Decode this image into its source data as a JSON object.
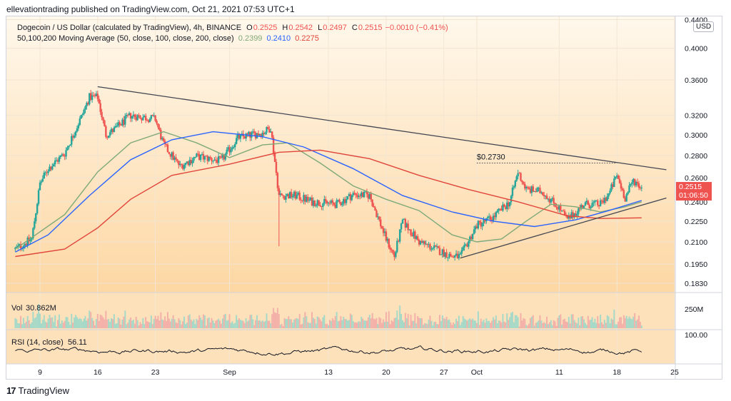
{
  "caption": "ellevationtrading published on TradingView.com, Oct 21, 2021 07:53 UTC+1",
  "legend": {
    "symbol": "Dogecoin / US Dollar (calculated by TradingView), 4h, BINANCE",
    "o_label": "O",
    "o": "0.2525",
    "h_label": "H",
    "h": "0.2542",
    "l_label": "L",
    "l": "0.2497",
    "c_label": "C",
    "c": "0.2515",
    "change": "−0.0010 (−0.41%)",
    "ma_title": "50,100,200 Moving Average (50, close, 100, close, 200, close)",
    "ma50": "0.2399",
    "ma100": "0.2410",
    "ma200": "0.2275"
  },
  "currency": "USD",
  "annotation_price": "$0.2730",
  "last_price": "0.2515",
  "countdown": "01:06:50",
  "volume_label": "Vol",
  "volume_value": "30.862M",
  "volume_axis": "250M",
  "rsi_label": "RSI (14, close)",
  "rsi_value": "56.11",
  "rsi_axis": "100.00",
  "footer": {
    "logo": "17",
    "brand": "TradingView"
  },
  "colors": {
    "bg_top": "#fff8ec",
    "bg_bottom": "#fdd7a3",
    "up": "#26a69a",
    "down": "#ef5350",
    "ma50": "#7fa978",
    "ma100": "#2962ff",
    "ma200": "#e0453b",
    "trendline": "#434651"
  },
  "chart_data": {
    "type": "candlestick",
    "title": "Dogecoin / US Dollar (calculated by TradingView), 4h, BINANCE",
    "y_scale": "log",
    "ylim": [
      0.176,
      0.44
    ],
    "y_ticks": [
      "0.4400",
      "0.4000",
      "0.3600",
      "0.3200",
      "0.3000",
      "0.2800",
      "0.2600",
      "0.2400",
      "0.2250",
      "0.2100",
      "0.1950",
      "0.1830"
    ],
    "x_ticks": [
      "9",
      "16",
      "23",
      "Sep",
      "13",
      "20",
      "27",
      "Oct",
      "11",
      "18",
      "25"
    ],
    "price_path": [
      [
        "2021-08-06",
        0.205
      ],
      [
        "2021-08-08",
        0.212
      ],
      [
        "2021-08-09",
        0.255
      ],
      [
        "2021-08-10",
        0.268
      ],
      [
        "2021-08-12",
        0.282
      ],
      [
        "2021-08-14",
        0.318
      ],
      [
        "2021-08-15",
        0.34
      ],
      [
        "2021-08-16",
        0.34
      ],
      [
        "2021-08-17",
        0.3
      ],
      [
        "2021-08-18",
        0.305
      ],
      [
        "2021-08-20",
        0.32
      ],
      [
        "2021-08-23",
        0.316
      ],
      [
        "2021-08-24",
        0.29
      ],
      [
        "2021-08-26",
        0.27
      ],
      [
        "2021-08-28",
        0.279
      ],
      [
        "2021-08-31",
        0.275
      ],
      [
        "2021-09-02",
        0.297
      ],
      [
        "2021-09-05",
        0.302
      ],
      [
        "2021-09-06",
        0.307
      ],
      [
        "2021-09-07",
        0.245
      ],
      [
        "2021-09-09",
        0.245
      ],
      [
        "2021-09-11",
        0.24
      ],
      [
        "2021-09-14",
        0.238
      ],
      [
        "2021-09-16",
        0.246
      ],
      [
        "2021-09-18",
        0.245
      ],
      [
        "2021-09-20",
        0.212
      ],
      [
        "2021-09-21",
        0.2
      ],
      [
        "2021-09-22",
        0.225
      ],
      [
        "2021-09-24",
        0.21
      ],
      [
        "2021-09-26",
        0.205
      ],
      [
        "2021-09-28",
        0.2
      ],
      [
        "2021-09-29",
        0.2
      ],
      [
        "2021-10-01",
        0.222
      ],
      [
        "2021-10-03",
        0.228
      ],
      [
        "2021-10-05",
        0.24
      ],
      [
        "2021-10-06",
        0.265
      ],
      [
        "2021-10-07",
        0.25
      ],
      [
        "2021-10-09",
        0.248
      ],
      [
        "2021-10-11",
        0.235
      ],
      [
        "2021-10-12",
        0.226
      ],
      [
        "2021-10-14",
        0.238
      ],
      [
        "2021-10-16",
        0.238
      ],
      [
        "2021-10-17",
        0.246
      ],
      [
        "2021-10-18",
        0.262
      ],
      [
        "2021-10-19",
        0.243
      ],
      [
        "2021-10-20",
        0.258
      ],
      [
        "2021-10-21",
        0.2515
      ]
    ],
    "spike_low": {
      "date": "2021-09-07",
      "value": 0.207
    },
    "series": [
      {
        "name": "MA 50",
        "values": [
          [
            "2021-08-06",
            0.205
          ],
          [
            "2021-08-12",
            0.23
          ],
          [
            "2021-08-16",
            0.265
          ],
          [
            "2021-08-20",
            0.292
          ],
          [
            "2021-08-24",
            0.303
          ],
          [
            "2021-08-28",
            0.292
          ],
          [
            "2021-09-01",
            0.278
          ],
          [
            "2021-09-05",
            0.29
          ],
          [
            "2021-09-08",
            0.292
          ],
          [
            "2021-09-12",
            0.273
          ],
          [
            "2021-09-16",
            0.253
          ],
          [
            "2021-09-20",
            0.242
          ],
          [
            "2021-09-24",
            0.233
          ],
          [
            "2021-09-28",
            0.215
          ],
          [
            "2021-10-01",
            0.21
          ],
          [
            "2021-10-04",
            0.212
          ],
          [
            "2021-10-07",
            0.225
          ],
          [
            "2021-10-10",
            0.238
          ],
          [
            "2021-10-13",
            0.236
          ],
          [
            "2021-10-16",
            0.232
          ],
          [
            "2021-10-19",
            0.236
          ],
          [
            "2021-10-21",
            0.2399
          ]
        ]
      },
      {
        "name": "MA 100",
        "values": [
          [
            "2021-08-06",
            0.203
          ],
          [
            "2021-08-10",
            0.215
          ],
          [
            "2021-08-15",
            0.245
          ],
          [
            "2021-08-20",
            0.276
          ],
          [
            "2021-08-25",
            0.295
          ],
          [
            "2021-08-30",
            0.303
          ],
          [
            "2021-09-05",
            0.298
          ],
          [
            "2021-09-10",
            0.288
          ],
          [
            "2021-09-16",
            0.268
          ],
          [
            "2021-09-22",
            0.245
          ],
          [
            "2021-09-28",
            0.232
          ],
          [
            "2021-10-03",
            0.225
          ],
          [
            "2021-10-08",
            0.221
          ],
          [
            "2021-10-13",
            0.226
          ],
          [
            "2021-10-17",
            0.233
          ],
          [
            "2021-10-21",
            0.241
          ]
        ]
      },
      {
        "name": "MA 200",
        "values": [
          [
            "2021-08-06",
            0.2
          ],
          [
            "2021-08-12",
            0.205
          ],
          [
            "2021-08-16",
            0.22
          ],
          [
            "2021-08-20",
            0.242
          ],
          [
            "2021-08-25",
            0.262
          ],
          [
            "2021-09-01",
            0.272
          ],
          [
            "2021-09-07",
            0.283
          ],
          [
            "2021-09-12",
            0.285
          ],
          [
            "2021-09-18",
            0.277
          ],
          [
            "2021-09-24",
            0.262
          ],
          [
            "2021-09-30",
            0.25
          ],
          [
            "2021-10-06",
            0.24
          ],
          [
            "2021-10-12",
            0.229
          ],
          [
            "2021-10-16",
            0.227
          ],
          [
            "2021-10-21",
            0.2275
          ]
        ]
      }
    ],
    "trendlines": [
      {
        "from": [
          "2021-08-16",
          0.352
        ],
        "to": [
          "2021-10-24",
          0.267
        ]
      },
      {
        "from": [
          "2021-09-29",
          0.199
        ],
        "to": [
          "2021-10-24",
          0.243
        ]
      }
    ],
    "horizontal_levels": [
      {
        "value": 0.273,
        "from": "2021-10-01",
        "to": "2021-10-18",
        "style": "dotted"
      }
    ],
    "volume": {
      "axis_max": "250M",
      "last": "30.862M"
    },
    "rsi": {
      "period": 14,
      "last": 56.11,
      "axis_max": "100.00"
    }
  }
}
